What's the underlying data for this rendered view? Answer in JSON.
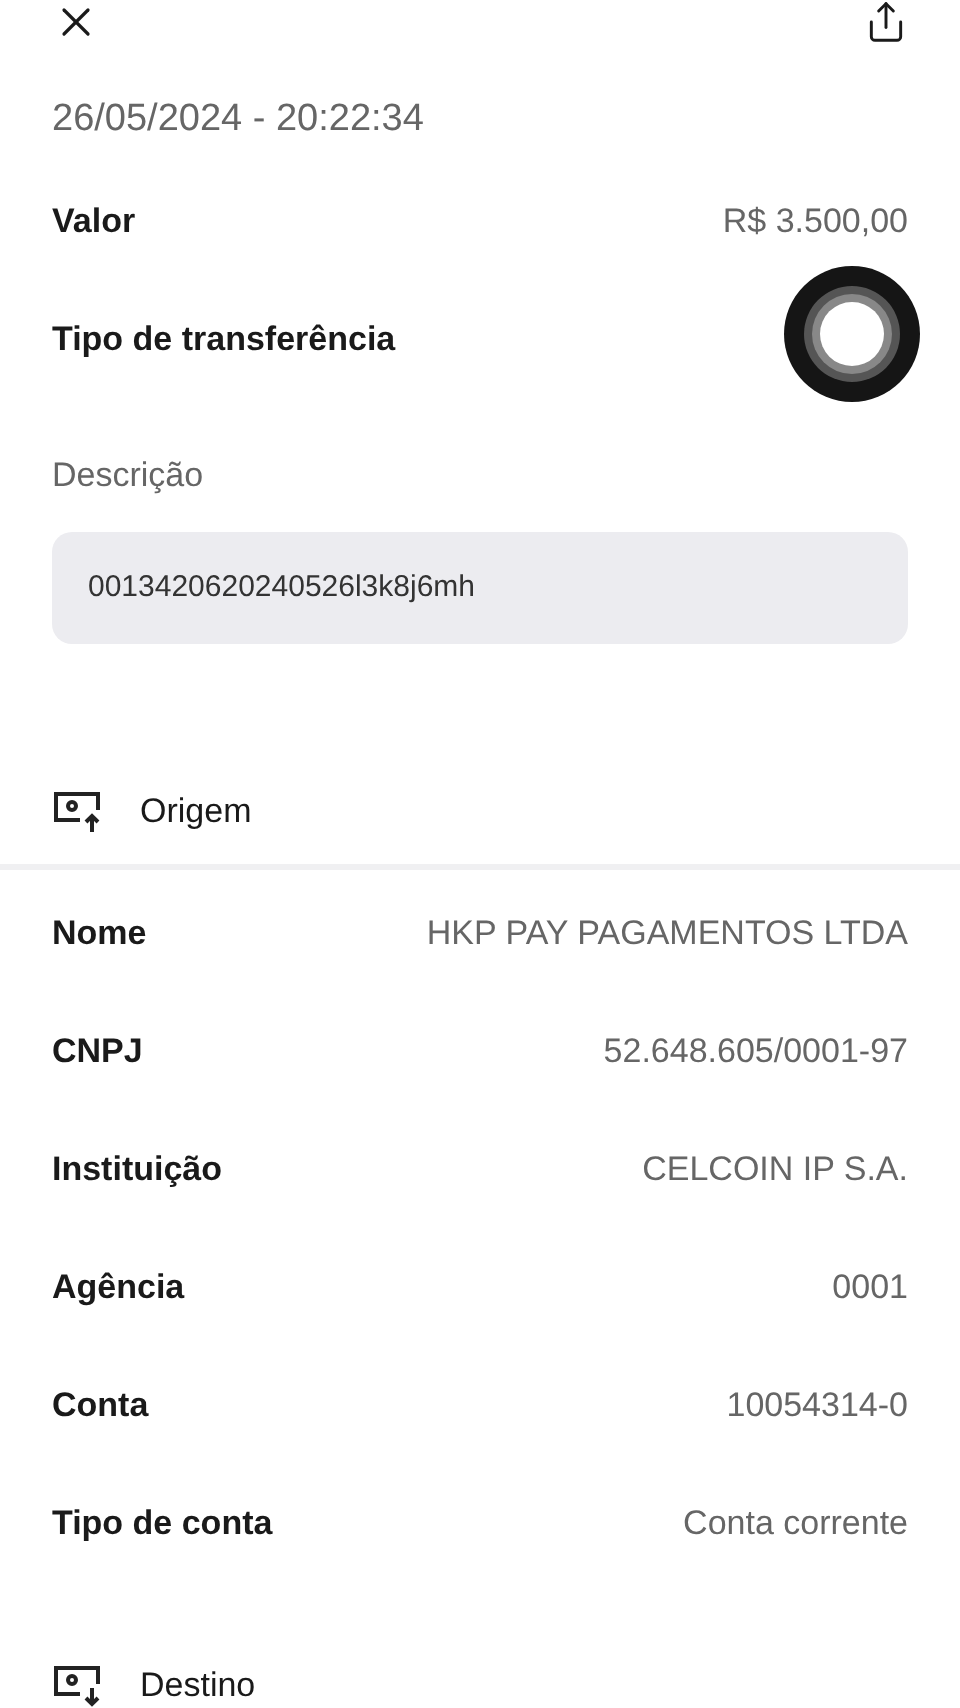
{
  "datetime": "26/05/2024 - 20:22:34",
  "summary": [
    {
      "label": "Valor",
      "value": "R$ 3.500,00",
      "loading": false
    },
    {
      "label": "Tipo de transferência",
      "loading": true
    }
  ],
  "description": {
    "label": "Descrição",
    "value": "0013420620240526l3k8j6mh"
  },
  "sections": [
    {
      "kind": "outgoing",
      "title": "Origem",
      "rows": [
        {
          "label": "Nome",
          "value": "HKP PAY PAGAMENTOS LTDA"
        },
        {
          "label": "CNPJ",
          "value": "52.648.605/0001-97"
        },
        {
          "label": "Instituição",
          "value": "CELCOIN IP S.A."
        },
        {
          "label": "Agência",
          "value": "0001"
        },
        {
          "label": "Conta",
          "value": "10054314-0"
        },
        {
          "label": "Tipo de conta",
          "value": "Conta corrente"
        }
      ]
    },
    {
      "kind": "incoming",
      "title": "Destino"
    }
  ]
}
